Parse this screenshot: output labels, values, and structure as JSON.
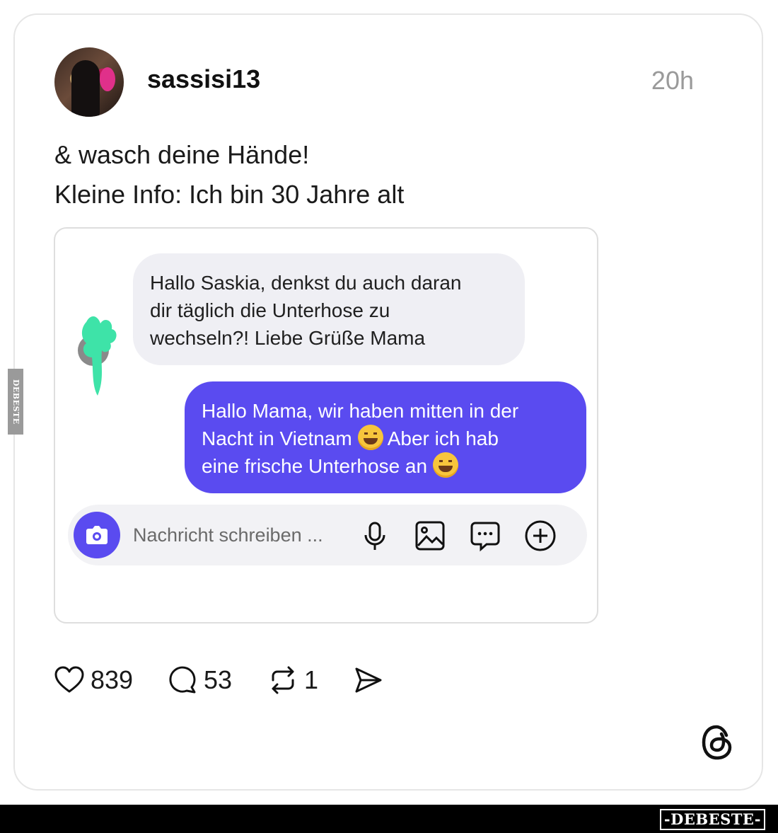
{
  "post": {
    "username": "sassisi13",
    "time": "20h",
    "text_lines": [
      "& wasch deine Hände!",
      "Kleine Info: Ich bin 30 Jahre alt"
    ]
  },
  "chat": {
    "incoming": [
      "Hallo Saskia, denkst du auch daran",
      "dir täglich die Unterhose zu",
      "wechseln?! Liebe Grüße Mama"
    ],
    "outgoing": {
      "line1": "Hallo Mama, wir haben mitten in der",
      "line2_a": "Nacht in Vietnam",
      "line2_b": "Aber ich hab",
      "line3": "eine frische Unterhose an"
    },
    "compose_placeholder": "Nachricht schreiben ...",
    "accent_color": "#5a4bf0"
  },
  "actions": {
    "likes": "839",
    "comments": "53",
    "reposts": "1"
  },
  "watermark": {
    "brand": "-DEBESTE-",
    "side": "DEBESTE"
  }
}
